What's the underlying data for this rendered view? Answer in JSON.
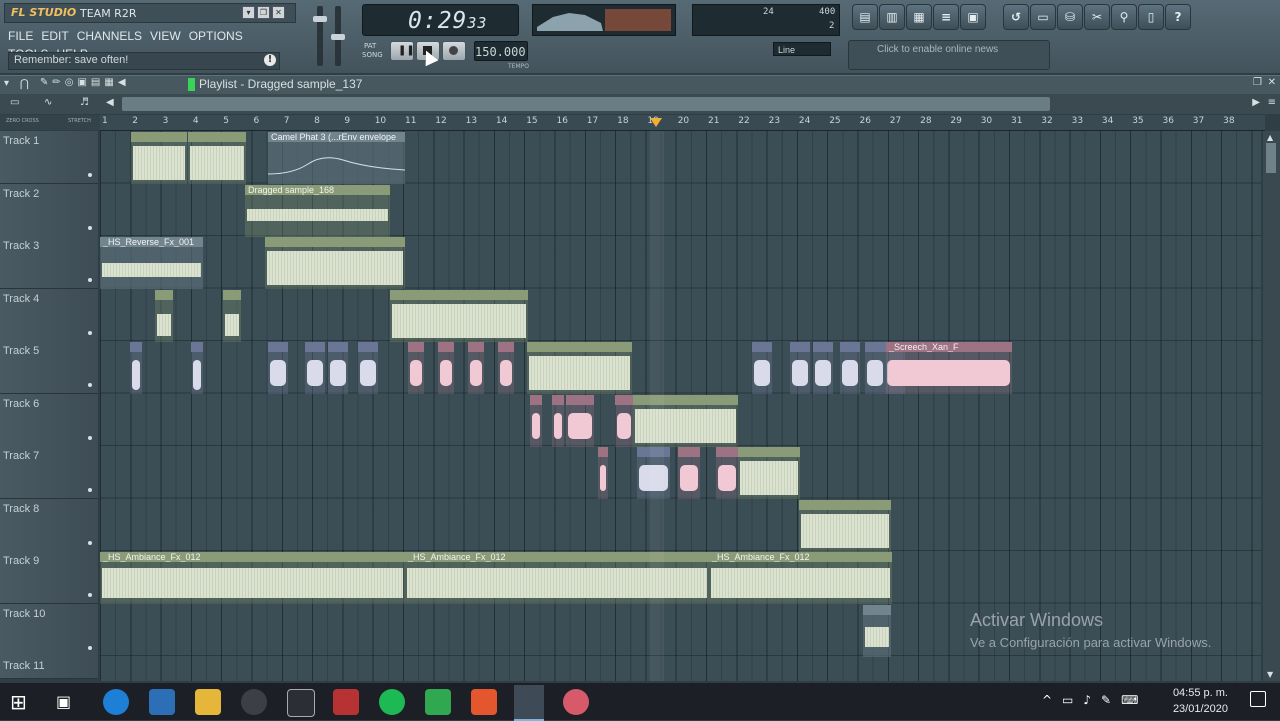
{
  "app": {
    "brand": "FL STUDIO",
    "team": "TEAM R2R"
  },
  "menu": [
    "FILE",
    "EDIT",
    "CHANNELS",
    "VIEW",
    "OPTIONS",
    "TOOLS",
    "HELP"
  ],
  "hint": "Remember: save often!",
  "hint_icon": "info-icon",
  "transport": {
    "time": "0:29",
    "time_ms": "33",
    "tempo": "150.000",
    "pat_label": "PAT",
    "song_label": "SONG",
    "tempo_label": "TEMPO"
  },
  "cpu": {
    "value1": "24",
    "value2": "400",
    "value3": "2"
  },
  "snap": "Line",
  "news": "Click to enable online news",
  "playlist": {
    "title": "Playlist - Dragged sample_137",
    "zero_cross": "ZERO CROSS",
    "stretch": "STRETCH"
  },
  "ruler": [
    "1",
    "2",
    "3",
    "4",
    "5",
    "6",
    "7",
    "8",
    "9",
    "10",
    "11",
    "12",
    "13",
    "14",
    "15",
    "16",
    "17",
    "18",
    "19",
    "20",
    "21",
    "22",
    "23",
    "24",
    "25",
    "26",
    "27",
    "28",
    "29",
    "30",
    "31",
    "32",
    "33",
    "34",
    "35",
    "36",
    "37",
    "38"
  ],
  "tracks": [
    "Track 1",
    "Track 2",
    "Track 3",
    "Track 4",
    "Track 5",
    "Track 6",
    "Track 7",
    "Track 8",
    "Track 9",
    "Track 10",
    "Track 11"
  ],
  "clips": {
    "camel": "Camel Phat 3 (...rEnv envelope",
    "dragged": "Dragged sample_168",
    "reverse": "_HS_Reverse_Fx_001",
    "screech": "_Screech_Xan_F",
    "amb1": "_HS_Ambiance_Fx_012",
    "amb2": "_HS_Ambiance_Fx_012",
    "amb3": "_HS_Ambiance_Fx_012"
  },
  "watermark": {
    "line1": "Activar Windows",
    "line2": "Ve a Configuración para activar Windows."
  },
  "clock": {
    "time": "04:55 p. m.",
    "date": "23/01/2020"
  }
}
